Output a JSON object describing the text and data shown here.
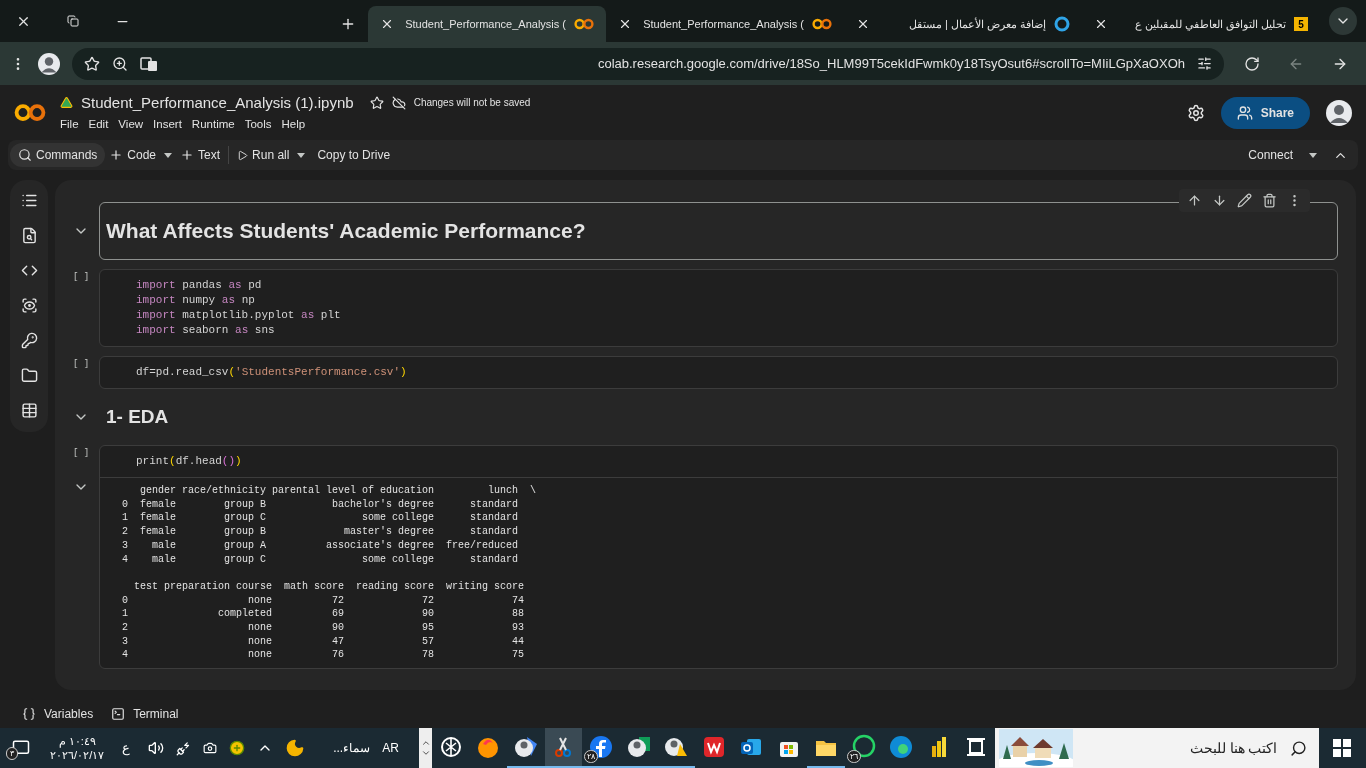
{
  "browser": {
    "tabs": [
      {
        "title": "Student_Performance_Analysis (",
        "selected": true,
        "favicon": {
          "kind": "colab"
        }
      },
      {
        "title": "Student_Performance_Analysis (",
        "selected": false,
        "favicon": {
          "kind": "colab"
        }
      },
      {
        "title": "إضافة معرض الأعمال | مستقل",
        "selected": false,
        "favicon": {
          "kind": "ring"
        }
      },
      {
        "title": "تحليل التوافق العاطفي للمقبلين ع",
        "selected": false,
        "favicon": {
          "kind": "number",
          "text": "5"
        }
      }
    ],
    "address": "colab.research.google.com/drive/18So_HLM99T5cekIdFwmk0y18TsyOsut6#scrollTo=MIiLGpXaOXOh"
  },
  "colab": {
    "file_name": "Student_Performance_Analysis (1).ipynb",
    "save_notice": "Changes will not be saved",
    "menu": [
      "File",
      "Edit",
      "View",
      "Insert",
      "Runtime",
      "Tools",
      "Help"
    ],
    "share": "Share",
    "toolbar": [
      {
        "kind": "search",
        "label": "Commands"
      },
      {
        "kind": "add",
        "label": "Code"
      },
      {
        "kind": "caret"
      },
      {
        "kind": "add",
        "label": "Text"
      },
      {
        "kind": "divider"
      },
      {
        "kind": "run",
        "label": "Run all"
      },
      {
        "kind": "caret"
      },
      {
        "kind": "plain",
        "label": "Copy to Drive"
      }
    ],
    "connect": "Connect"
  },
  "cells": [
    {
      "kind": "title",
      "text": "What Affects Students' Academic Performance?",
      "selected": true
    },
    {
      "kind": "code",
      "prompt": "[ ]",
      "selected": false,
      "lines": [
        [
          {
            "text": "import",
            "kind": "keyword"
          },
          {
            "text": " pandas ",
            "kind": "plain"
          },
          {
            "text": "as",
            "kind": "keyword"
          },
          {
            "text": " pd",
            "kind": "plain"
          }
        ],
        [
          {
            "text": "import",
            "kind": "keyword"
          },
          {
            "text": " numpy ",
            "kind": "plain"
          },
          {
            "text": "as",
            "kind": "keyword"
          },
          {
            "text": " np",
            "kind": "plain"
          }
        ],
        [
          {
            "text": "import",
            "kind": "keyword"
          },
          {
            "text": " matplotlib.pyplot ",
            "kind": "plain"
          },
          {
            "text": "as",
            "kind": "keyword"
          },
          {
            "text": " plt",
            "kind": "plain"
          }
        ],
        [
          {
            "text": "import",
            "kind": "keyword"
          },
          {
            "text": " seaborn ",
            "kind": "plain"
          },
          {
            "text": "as",
            "kind": "keyword"
          },
          {
            "text": " sns",
            "kind": "plain"
          }
        ]
      ]
    },
    {
      "kind": "code",
      "prompt": "[ ]",
      "selected": false,
      "lines": [
        [
          {
            "text": "df=pd.read_csv",
            "kind": "plain"
          },
          {
            "text": "(",
            "kind": "bracket"
          },
          {
            "text": "'StudentsPerformance.csv'",
            "kind": "string"
          },
          {
            "text": ")",
            "kind": "bracket"
          }
        ]
      ]
    },
    {
      "kind": "section",
      "text": "1- EDA",
      "selected": false
    },
    {
      "kind": "code",
      "prompt": "[ ]",
      "selected": false,
      "lines": [
        [
          {
            "text": "print",
            "kind": "plain"
          },
          {
            "text": "(",
            "kind": "bracket"
          },
          {
            "text": "df.head",
            "kind": "plain"
          },
          {
            "text": "()",
            "kind": "inner"
          },
          {
            "text": ")",
            "kind": "bracket"
          }
        ]
      ],
      "output": [
        {
          "lines": [
            "   gender race/ethnicity parental level of education         lunch  \\",
            "0  female        group B           bachelor's degree      standard",
            "1  female        group C                some college      standard",
            "2  female        group B             master's degree      standard",
            "3    male        group A          associate's degree  free/reduced",
            "4    male        group C                some college      standard"
          ]
        },
        {
          "lines": [
            "  test preparation course  math score  reading score  writing score",
            "0                    none          72             72             74",
            "1               completed          69             90             88",
            "2                    none          90             95             93",
            "3                    none          47             57             44",
            "4                    none          76             78             75"
          ]
        }
      ]
    }
  ],
  "bottom_bar": [
    {
      "kind": "braces",
      "label": "Variables"
    },
    {
      "kind": "terminal",
      "label": "Terminal"
    }
  ],
  "taskbar": {
    "search_placeholder": "اكتب هنا للبحث",
    "apps": [
      {
        "kind": "taskview",
        "running": false,
        "active": false
      },
      {
        "kind": "powerbi",
        "running": false,
        "active": false
      },
      {
        "kind": "edge",
        "running": false,
        "active": false
      },
      {
        "kind": "whatsapp",
        "running": false,
        "active": false,
        "badge": "٢٦"
      },
      {
        "kind": "explorer",
        "running": true,
        "active": false
      },
      {
        "kind": "store",
        "running": false,
        "active": false
      },
      {
        "kind": "outlook",
        "running": false,
        "active": false
      },
      {
        "kind": "wps",
        "running": false,
        "active": false
      },
      {
        "kind": "drive",
        "running": true,
        "active": false
      },
      {
        "kind": "sheets",
        "running": true,
        "active": false
      },
      {
        "kind": "facebook",
        "running": true,
        "active": false,
        "badge": "٢٨"
      },
      {
        "kind": "snipping",
        "running": true,
        "active": true
      },
      {
        "kind": "profile",
        "running": true,
        "active": false
      },
      {
        "kind": "firefox",
        "running": false,
        "active": false
      },
      {
        "kind": "chatgpt",
        "running": false,
        "active": false
      }
    ],
    "language": "AR",
    "weather": "سماء...",
    "keyboard": "ع",
    "time": "١٠:٤٩ م",
    "date": "٢٠٢٦/٠٢/١٧",
    "notification_badge": "٣"
  }
}
